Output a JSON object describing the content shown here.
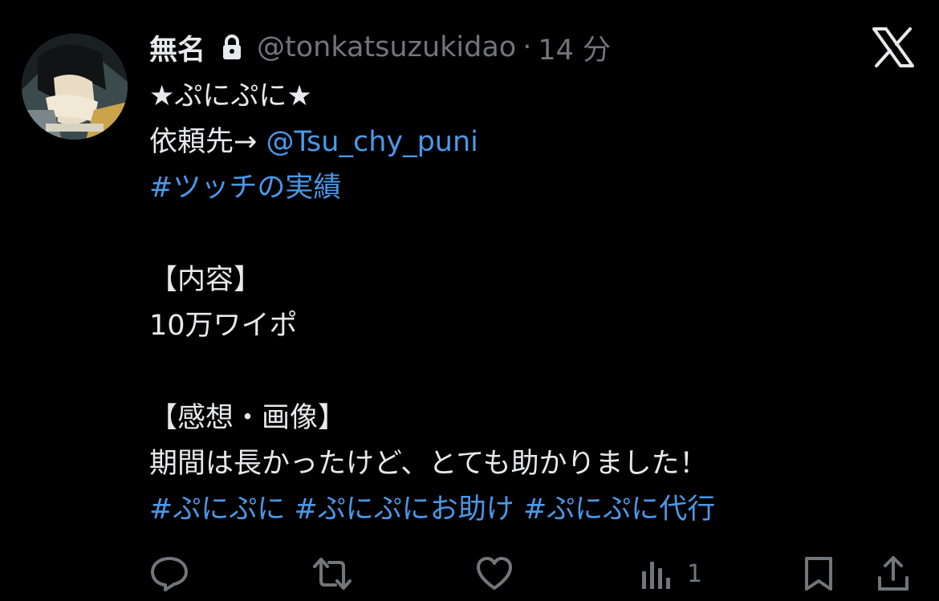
{
  "tweet": {
    "display_name": "無名",
    "handle": "@tonkatsuzukidao",
    "separator": "·",
    "timestamp": "14 分",
    "text": {
      "line1": "★ぷにぷに★",
      "line2_prefix": "依頼先→ ",
      "mention": "@Tsu_chy_puni",
      "hashtag1": "#ツッチの実績",
      "section1_heading": "【内容】",
      "section1_body": "10万ワイポ",
      "section2_heading": "【感想・画像】",
      "section2_body": "期間は長かったけど、とても助かりました！",
      "hashtag_a": "#ぷにぷに",
      "hashtag_b": "#ぷにぷにお助け",
      "hashtag_c": "#ぷにぷに代行"
    }
  },
  "actions": {
    "views_count": "1"
  },
  "icons": {
    "avatar": "avatar-image",
    "lock": "lock-icon",
    "brand": "x-logo-icon",
    "reply": "reply-icon",
    "retweet": "retweet-icon",
    "like": "heart-icon",
    "views": "bar-chart-icon",
    "bookmark": "bookmark-icon",
    "share": "share-icon"
  },
  "colors": {
    "background": "#000000",
    "primary_text": "#e7e9ea",
    "secondary_text": "#71767b",
    "link": "#4a99e9"
  }
}
